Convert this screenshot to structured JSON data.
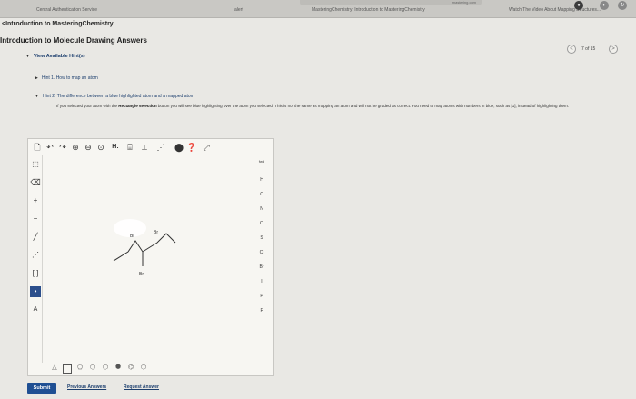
{
  "browser": {
    "tabs": [
      {
        "label": "Central Authentication Service"
      },
      {
        "label": "alert"
      },
      {
        "label": "MasteringChemistry: Introduction to MasteringChemistry"
      },
      {
        "label": "Watch The Video About Mapping Structures..."
      }
    ],
    "url": "mastering.com"
  },
  "breadcrumb": "<Introduction to MasteringChemistry",
  "page_title": "Introduction to Molecule Drawing Answers",
  "pager": {
    "prev": "<",
    "label": "7 of 15",
    "next": ">"
  },
  "hints": {
    "toggle_label": "View Available Hint(s)",
    "hint1": "Hint 1. How to map an atom",
    "hint2_title": "Hint 2. The difference between a blue highlighted atom and a mapped atom",
    "hint2_pre": "If you selected your atom with the ",
    "hint2_bold": "Rectangle selection",
    "hint2_post": " button you will see blue highlighting over the atom you selected. This is not the same as mapping an atom and will not be graded as correct. You need to map atoms with numbers in blue, such as [1], instead of highlighting them."
  },
  "editor": {
    "toolbar_icons": [
      "new-doc-icon",
      "undo-icon",
      "redo-icon",
      "zoom-in-icon",
      "zoom-out-icon",
      "zoom-fit-icon",
      "hydrogen-toggle-icon",
      "template-icon",
      "clean-icon",
      "stop-icon",
      "help-icon",
      "fullscreen-icon"
    ],
    "h_toggle": "H:",
    "molecule_labels": [
      "Br",
      "Br",
      "Br"
    ],
    "elements": [
      "H",
      "C",
      "N",
      "O",
      "S",
      "Cl",
      "Br",
      "I",
      "P",
      "F"
    ],
    "periodic_label": "fwd"
  },
  "footer": {
    "submit": "Submit",
    "previous_answers": "Previous Answers",
    "request_answer": "Request Answer"
  }
}
